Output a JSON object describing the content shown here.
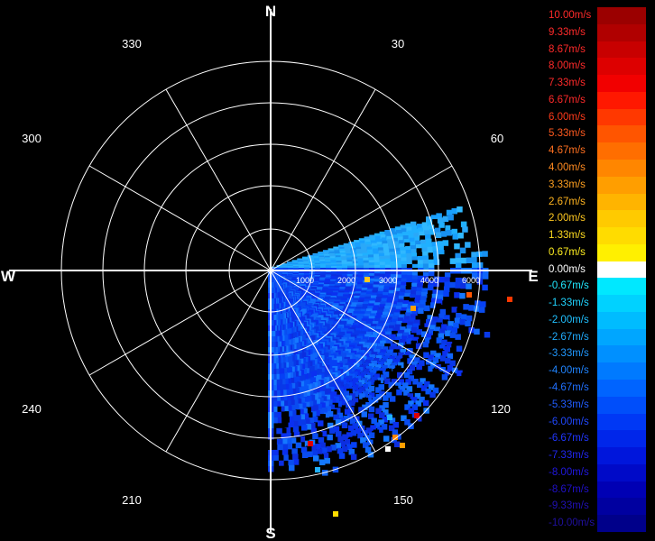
{
  "radar": {
    "cardinals": {
      "north": "N",
      "east": "E",
      "south": "S",
      "west": "W"
    },
    "azimuth_labels": [
      "30",
      "60",
      "120",
      "150",
      "210",
      "240",
      "300",
      "330"
    ],
    "range_labels": [
      "1000",
      "2000",
      "3000",
      "4000",
      "5000",
      "6000"
    ],
    "colors": {
      "background": "#000000",
      "grid": "#ffffff"
    }
  },
  "legend": {
    "items": [
      {
        "label": "10.00m/s",
        "color": "#9b0000",
        "text_color": "#ff2a2a"
      },
      {
        "label": "9.33m/s",
        "color": "#b00000",
        "text_color": "#ff2a2a"
      },
      {
        "label": "8.67m/s",
        "color": "#c80000",
        "text_color": "#ff2a2a"
      },
      {
        "label": "8.00m/s",
        "color": "#dd0000",
        "text_color": "#ff2a2a"
      },
      {
        "label": "7.33m/s",
        "color": "#f20000",
        "text_color": "#ff2a2a"
      },
      {
        "label": "6.67m/s",
        "color": "#ff1800",
        "text_color": "#ff2a2a"
      },
      {
        "label": "6.00m/s",
        "color": "#ff3800",
        "text_color": "#ff3a1a"
      },
      {
        "label": "5.33m/s",
        "color": "#ff5500",
        "text_color": "#ff5a20"
      },
      {
        "label": "4.67m/s",
        "color": "#ff6e00",
        "text_color": "#ff7020"
      },
      {
        "label": "4.00m/s",
        "color": "#ff8600",
        "text_color": "#ff8a20"
      },
      {
        "label": "3.33m/s",
        "color": "#ff9e00",
        "text_color": "#ffa020"
      },
      {
        "label": "2.67m/s",
        "color": "#ffb400",
        "text_color": "#ffb420"
      },
      {
        "label": "2.00m/s",
        "color": "#ffca00",
        "text_color": "#ffc820"
      },
      {
        "label": "1.33m/s",
        "color": "#ffdc00",
        "text_color": "#ffdc20"
      },
      {
        "label": "0.67m/s",
        "color": "#fff000",
        "text_color": "#ffee20"
      },
      {
        "label": "0.00m/s",
        "color": "#ffffff",
        "text_color": "#ffffff"
      },
      {
        "label": "-0.67m/s",
        "color": "#00e8ff",
        "text_color": "#20e8ff"
      },
      {
        "label": "-1.33m/s",
        "color": "#00d2ff",
        "text_color": "#20d4ff"
      },
      {
        "label": "-2.00m/s",
        "color": "#00bcff",
        "text_color": "#20c0ff"
      },
      {
        "label": "-2.67m/s",
        "color": "#00a6ff",
        "text_color": "#20acff"
      },
      {
        "label": "-3.33m/s",
        "color": "#0090ff",
        "text_color": "#2098ff"
      },
      {
        "label": "-4.00m/s",
        "color": "#007aff",
        "text_color": "#2084ff"
      },
      {
        "label": "-4.67m/s",
        "color": "#0064ff",
        "text_color": "#2070ff"
      },
      {
        "label": "-5.33m/s",
        "color": "#004efa",
        "text_color": "#205cff"
      },
      {
        "label": "-6.00m/s",
        "color": "#0038f5",
        "text_color": "#2048ff"
      },
      {
        "label": "-6.67m/s",
        "color": "#0026ea",
        "text_color": "#2036ff"
      },
      {
        "label": "-7.33m/s",
        "color": "#0016dc",
        "text_color": "#2026f0"
      },
      {
        "label": "-8.00m/s",
        "color": "#000ac8",
        "text_color": "#2018e0"
      },
      {
        "label": "-8.67m/s",
        "color": "#0000b4",
        "text_color": "#2010c8"
      },
      {
        "label": "-9.33m/s",
        "color": "#0000a0",
        "text_color": "#2010b4"
      },
      {
        "label": "-10.00m/s",
        "color": "#00008a",
        "text_color": "#2010a0"
      }
    ]
  }
}
